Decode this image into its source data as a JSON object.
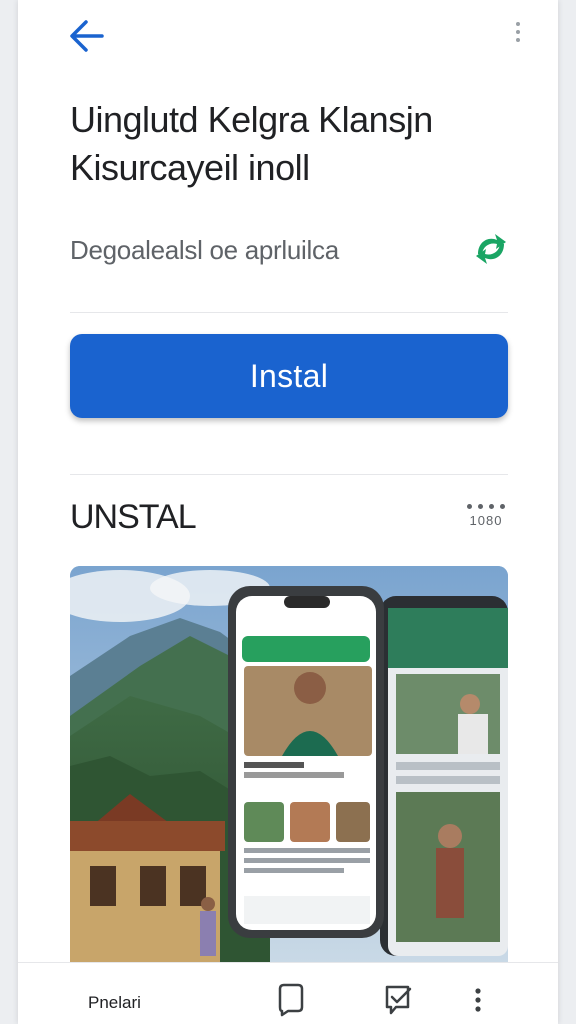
{
  "app": {
    "title_line1": "Uinglutd Kelgra Klansjn",
    "title_line2": "Kisurcayeil inoll",
    "subtitle": "Degoalealsl oe aprluilca"
  },
  "install": {
    "label": "Instal"
  },
  "section": {
    "title": "UNSTAL",
    "count": "1080"
  },
  "bottom_bar": {
    "label": "Pnelari"
  },
  "colors": {
    "accent": "#1a63cf",
    "share": "#1aa564",
    "text": "#202124",
    "muted": "#5f6368"
  },
  "icons": [
    "back-arrow-icon",
    "more-vert-icon",
    "share-icon",
    "more-horiz-icon",
    "bookmark-icon",
    "checklist-icon"
  ]
}
